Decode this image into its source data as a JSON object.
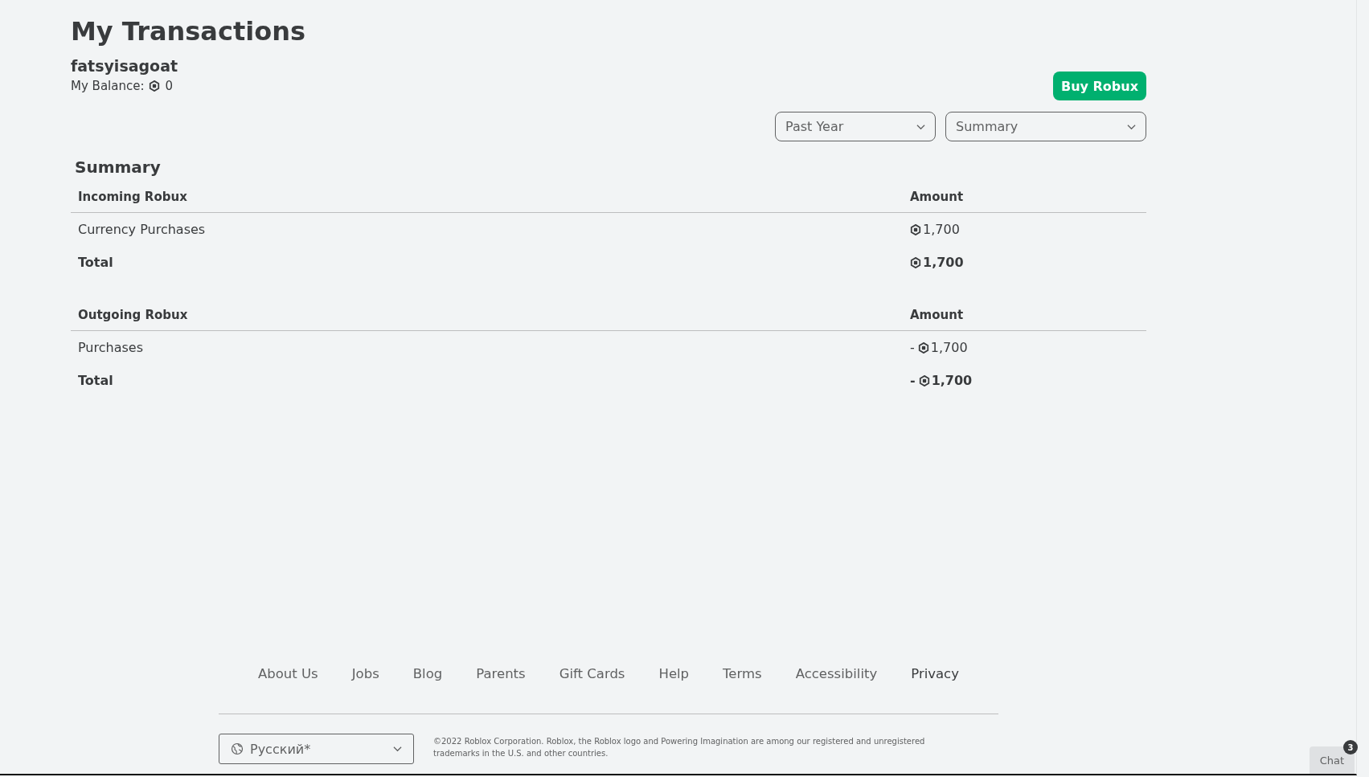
{
  "page_title": "My Transactions",
  "username": "fatsyisagoat",
  "balance": {
    "label": "My Balance:",
    "value": "0"
  },
  "buy_button": "Buy Robux",
  "filters": [
    {
      "value": "Past Year"
    },
    {
      "value": "Summary"
    }
  ],
  "summary": {
    "heading": "Summary",
    "sections": [
      {
        "label": "Incoming Robux",
        "amount_heading": "Amount",
        "rows": [
          {
            "kind": "item",
            "label": "Currency Purchases",
            "value": "1,700"
          },
          {
            "kind": "total",
            "label": "Total",
            "value": "1,700"
          }
        ]
      },
      {
        "label": "Outgoing Robux",
        "amount_heading": "Amount",
        "rows": [
          {
            "kind": "item",
            "label": "Purchases",
            "sign": "-",
            "value": "1,700"
          },
          {
            "kind": "total",
            "label": "Total",
            "sign": "-",
            "value": "1,700"
          }
        ]
      }
    ]
  },
  "footer": {
    "links": [
      {
        "label": "About Us",
        "emphasized": false
      },
      {
        "label": "Jobs",
        "emphasized": false
      },
      {
        "label": "Blog",
        "emphasized": false
      },
      {
        "label": "Parents",
        "emphasized": false
      },
      {
        "label": "Gift Cards",
        "emphasized": false
      },
      {
        "label": "Help",
        "emphasized": false
      },
      {
        "label": "Terms",
        "emphasized": false
      },
      {
        "label": "Accessibility",
        "emphasized": false
      },
      {
        "label": "Privacy",
        "emphasized": true
      }
    ],
    "language": "Русский*",
    "copyright": "©2022 Roblox Corporation. Roblox, the Roblox logo and Powering Imagination are among our registered and unregistered trademarks in the U.S. and other countries."
  },
  "chat": {
    "label": "Chat",
    "badge": "3"
  }
}
